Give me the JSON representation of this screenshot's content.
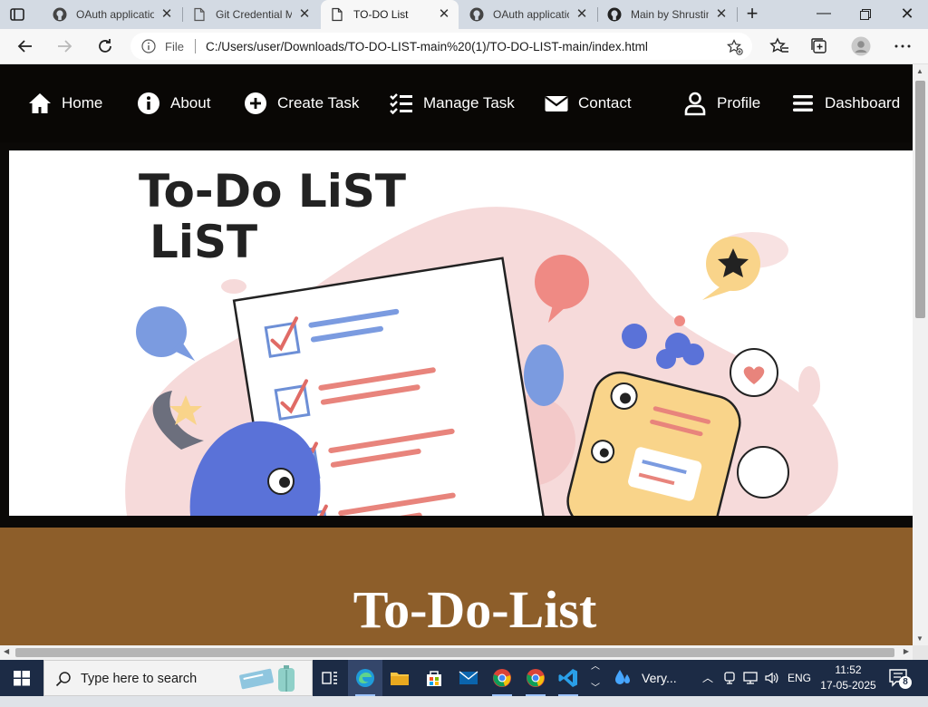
{
  "browser": {
    "tabs": [
      {
        "title": "OAuth applicatio",
        "favicon": "github-icon",
        "active": false
      },
      {
        "title": "Git Credential M",
        "favicon": "document-icon",
        "active": false
      },
      {
        "title": "TO-DO List",
        "favicon": "document-icon",
        "active": true
      },
      {
        "title": "OAuth applicatio",
        "favicon": "github-icon",
        "active": false
      },
      {
        "title": "Main by Shrustim",
        "favicon": "github-icon",
        "active": false
      }
    ],
    "address": {
      "scheme_label": "File",
      "url": "C:/Users/user/Downloads/TO-DO-LIST-main%20(1)/TO-DO-LIST-main/index.html"
    }
  },
  "page": {
    "nav": [
      {
        "label": "Home",
        "icon": "home-icon"
      },
      {
        "label": "About",
        "icon": "info-icon"
      },
      {
        "label": "Create Task",
        "icon": "plus-circle-icon"
      },
      {
        "label": "Manage Task",
        "icon": "checklist-icon"
      },
      {
        "label": "Contact",
        "icon": "envelope-icon"
      },
      {
        "label": "Profile",
        "icon": "user-icon"
      },
      {
        "label": "Dashboard",
        "icon": "menu-icon"
      }
    ],
    "hero": {
      "title_line1": "To-Do LiST",
      "title_line2": "LiST"
    },
    "heading": "To-Do-List",
    "colors": {
      "navbar": "#090705",
      "section": "#8d5e2a"
    }
  },
  "taskbar": {
    "search_placeholder": "Type here to search",
    "weather": "Very...",
    "language": "ENG",
    "time": "11:52",
    "date": "17-05-2025",
    "notification_count": "8"
  }
}
